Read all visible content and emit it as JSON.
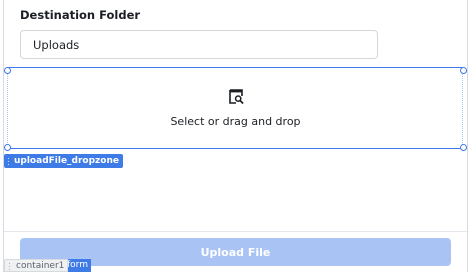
{
  "form": {
    "destination_label": "Destination Folder",
    "destination_value": "Uploads",
    "dropzone_text": "Select or drag and drop",
    "dropzone_icon": "file-search-icon",
    "upload_button_label": "Upload File"
  },
  "editor": {
    "dropzone_tag": "uploadFile_dropzone",
    "form_tag": "form",
    "container_tag": "container1"
  },
  "colors": {
    "selection": "#3e7be6",
    "button_disabled": "#a9c3f4"
  }
}
